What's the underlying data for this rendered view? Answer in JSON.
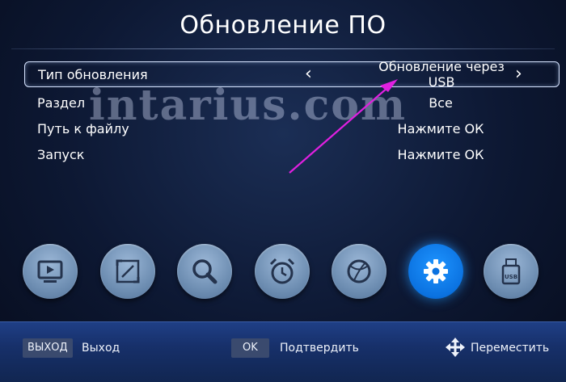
{
  "screen": {
    "title": "Обновление ПО"
  },
  "menu": {
    "items": [
      {
        "label": "Тип обновления",
        "value": "Обновление через USB"
      },
      {
        "label": "Раздел",
        "value": "Все"
      },
      {
        "label": "Путь к файлу",
        "value": "Нажмите ОК"
      },
      {
        "label": "Запуск",
        "value": "Нажмите ОК"
      }
    ],
    "selected_index": 0
  },
  "watermark": {
    "text": "intarius.com"
  },
  "toolbar": {
    "icons": [
      "tv-icon",
      "picture-icon",
      "search-icon",
      "alarm-clock-icon",
      "ball-icon",
      "gear-icon",
      "usb-icon"
    ],
    "active": "gear-icon"
  },
  "footer": {
    "exit_key": "ВЫХОД",
    "exit_label": "Выход",
    "ok_key": "OK",
    "ok_label": "Подтвердить",
    "move_label": "Переместить"
  },
  "colors": {
    "active_icon": "#0b72e0",
    "pointer_arrow": "#e020e0",
    "bottom_bar": "#1f3f86"
  }
}
